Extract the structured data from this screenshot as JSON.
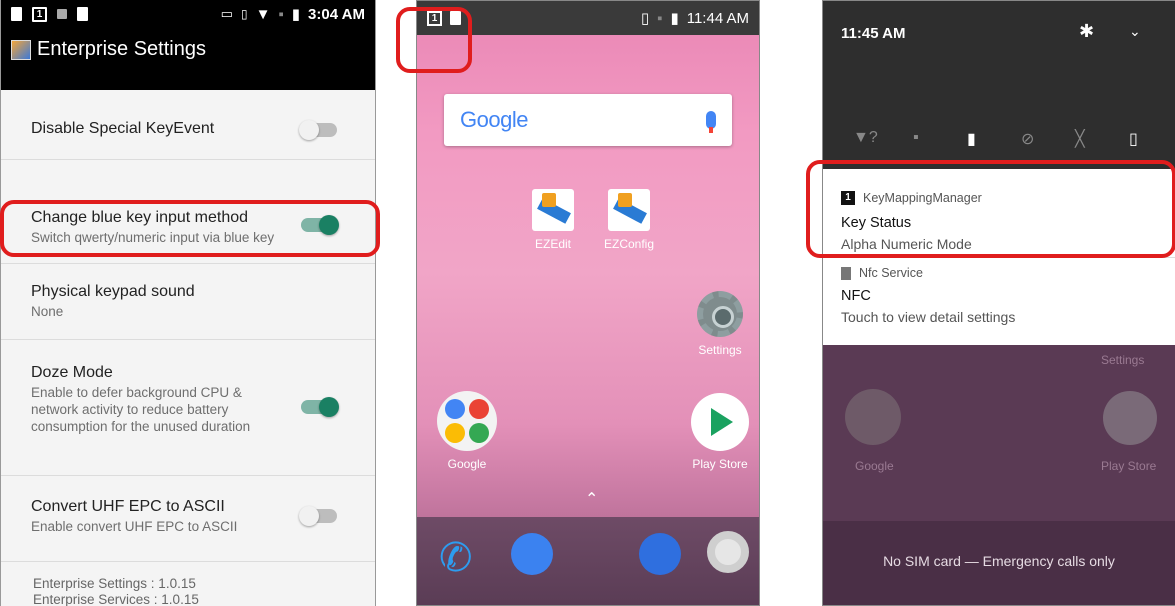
{
  "panel1": {
    "status_time": "3:04 AM",
    "status_left_icons": [
      "notification-icon",
      "key-1-icon",
      "no-call-icon",
      "sim-icon"
    ],
    "status_right_icons": [
      "screen-cast-icon",
      "vibrate-icon",
      "wifi-icon",
      "no-sim-icon",
      "battery-icon"
    ],
    "title": "Enterprise Settings",
    "settings": [
      {
        "title": "Disable Special KeyEvent",
        "subtitle": "",
        "toggle": "off"
      },
      {
        "title": "Change blue key input method",
        "subtitle": "Switch qwerty/numeric input via blue key",
        "toggle": "on"
      },
      {
        "title": "Physical keypad sound",
        "subtitle": "None",
        "toggle": ""
      },
      {
        "title": "Doze Mode",
        "subtitle": "Enable to defer background CPU & network activity to reduce battery consumption for the unused duration",
        "toggle": "on"
      },
      {
        "title": "Convert UHF EPC to ASCII",
        "subtitle": "Enable convert UHF EPC to ASCII",
        "toggle": "off"
      }
    ],
    "footer": [
      "Enterprise Settings : 1.0.15",
      "Enterprise Services : 1.0.15"
    ]
  },
  "panel2": {
    "status_time": "11:44 AM",
    "status_badge": "1",
    "search_logo": "Google",
    "apps": [
      {
        "label": "EZEdit",
        "icon": "ezedit-icon"
      },
      {
        "label": "EZConfig",
        "icon": "ezconfig-icon"
      },
      {
        "label": "Settings",
        "icon": "settings-gear-icon"
      },
      {
        "label": "Google",
        "icon": "google-folder-icon"
      },
      {
        "label": "Play Store",
        "icon": "play-store-icon"
      }
    ],
    "dock": [
      "phone-icon",
      "messages-icon",
      "contacts-icon",
      "camera-icon"
    ],
    "colors": {
      "highlight": "#e01d1d"
    }
  },
  "panel3": {
    "time": "11:45 AM",
    "quick_settings": [
      "wifi-unknown-icon",
      "no-sim-icon",
      "battery-icon",
      "dnd-off-icon",
      "flashlight-off-icon",
      "rotate-icon"
    ],
    "notifications": [
      {
        "app": "KeyMappingManager",
        "title": "Key Status",
        "body": "Alpha Numeric Mode",
        "badge": "1"
      },
      {
        "app": "Nfc Service",
        "title": "NFC",
        "body": "Touch to view detail settings",
        "badge": ""
      }
    ],
    "dim_labels": {
      "settings": "Settings",
      "google": "Google",
      "play_store": "Play Store"
    },
    "emergency": "No SIM card — Emergency calls only"
  }
}
